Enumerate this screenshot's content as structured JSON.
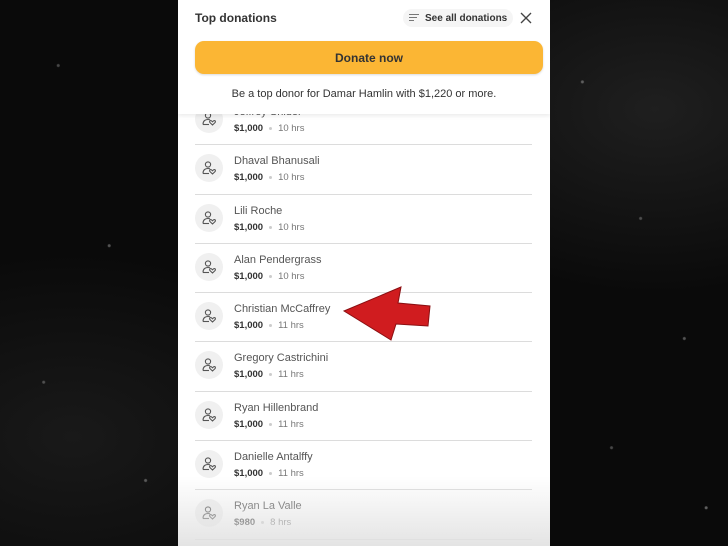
{
  "background": {
    "color": "#0a0a0a"
  },
  "header": {
    "title": "Top donations",
    "see_all_label": "See all donations",
    "see_all_icon": "filter-lines-icon",
    "close_icon": "close-icon"
  },
  "donate_button": {
    "label": "Donate now",
    "color": "#fbb634"
  },
  "promo_text": "Be a top donor for Damar Hamlin with $1,220 or more.",
  "donations": [
    {
      "name": "Jeffrey Snider",
      "amount": "$1,000",
      "time": "10 hrs",
      "partially_hidden": true
    },
    {
      "name": "Dhaval Bhanusali",
      "amount": "$1,000",
      "time": "10 hrs"
    },
    {
      "name": "Lili Roche",
      "amount": "$1,000",
      "time": "10 hrs"
    },
    {
      "name": "Alan Pendergrass",
      "amount": "$1,000",
      "time": "10 hrs"
    },
    {
      "name": "Christian McCaffrey",
      "amount": "$1,000",
      "time": "11 hrs",
      "highlighted": true
    },
    {
      "name": "Gregory Castrichini",
      "amount": "$1,000",
      "time": "11 hrs"
    },
    {
      "name": "Ryan Hillenbrand",
      "amount": "$1,000",
      "time": "11 hrs"
    },
    {
      "name": "Danielle Antalffy",
      "amount": "$1,000",
      "time": "11 hrs"
    },
    {
      "name": "Ryan La Valle",
      "amount": "$980",
      "time": "8 hrs"
    }
  ],
  "annotation": {
    "type": "red-arrow",
    "points_to": "Christian McCaffrey",
    "color": "#d01c1f"
  },
  "donor_icon": "donor-heart-icon"
}
